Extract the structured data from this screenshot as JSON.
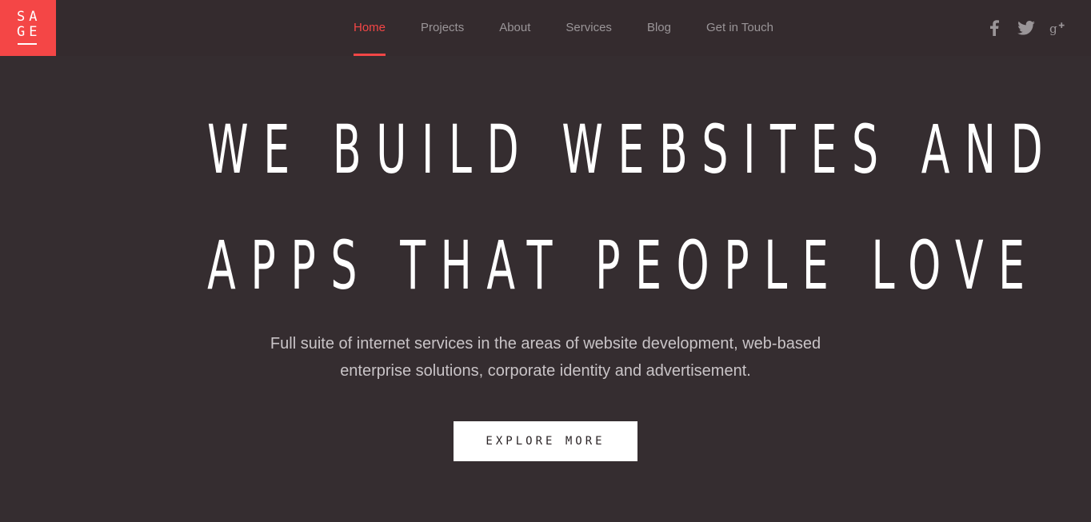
{
  "brand": {
    "logo_row1": "SA",
    "logo_row2": "GE",
    "color": "#f44646"
  },
  "nav": {
    "items": [
      {
        "label": "Home",
        "active": true
      },
      {
        "label": "Projects",
        "active": false
      },
      {
        "label": "About",
        "active": false
      },
      {
        "label": "Services",
        "active": false
      },
      {
        "label": "Blog",
        "active": false
      },
      {
        "label": "Get in Touch",
        "active": false
      }
    ]
  },
  "social": {
    "icons": [
      "facebook-icon",
      "twitter-icon",
      "google-plus-icon"
    ]
  },
  "hero": {
    "title_line1": "WE BUILD WEBSITES AND",
    "title_line2": "APPS THAT PEOPLE LOVE",
    "subtitle_line1": "Full suite of internet services in the areas of website development, web-based",
    "subtitle_line2": "enterprise solutions, corporate identity and advertisement.",
    "cta_label": "EXPLORE MORE"
  },
  "colors": {
    "background": "#352d30",
    "accent": "#f44646",
    "text": "#ffffff"
  }
}
